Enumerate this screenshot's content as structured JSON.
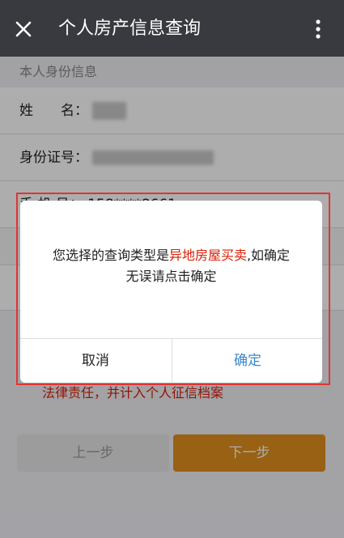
{
  "header": {
    "title": "个人房产信息查询",
    "close_icon": "close-icon",
    "more_icon": "more-vertical-icon"
  },
  "form": {
    "section_title": "本人身份信息",
    "name_label": "姓　　名：",
    "id_label": "身份证号：",
    "phone_label": "手 机 号：",
    "phone_value": "158****8661"
  },
  "warning": {
    "text": "法律责任，并计入个人征信档案"
  },
  "buttons": {
    "prev": "上一步",
    "next": "下一步"
  },
  "dialog": {
    "message_prefix": "您选择的查询类型是",
    "message_highlight": "异地房屋买卖",
    "message_suffix": ",如确定",
    "message_line2": "无误请点击确定",
    "cancel": "取消",
    "confirm": "确定"
  },
  "colors": {
    "topbar": "#393a3f",
    "accent": "#e08f1d",
    "highlight": "#d81e06",
    "link": "#3a87c8",
    "annotation_box": "#e03434"
  }
}
